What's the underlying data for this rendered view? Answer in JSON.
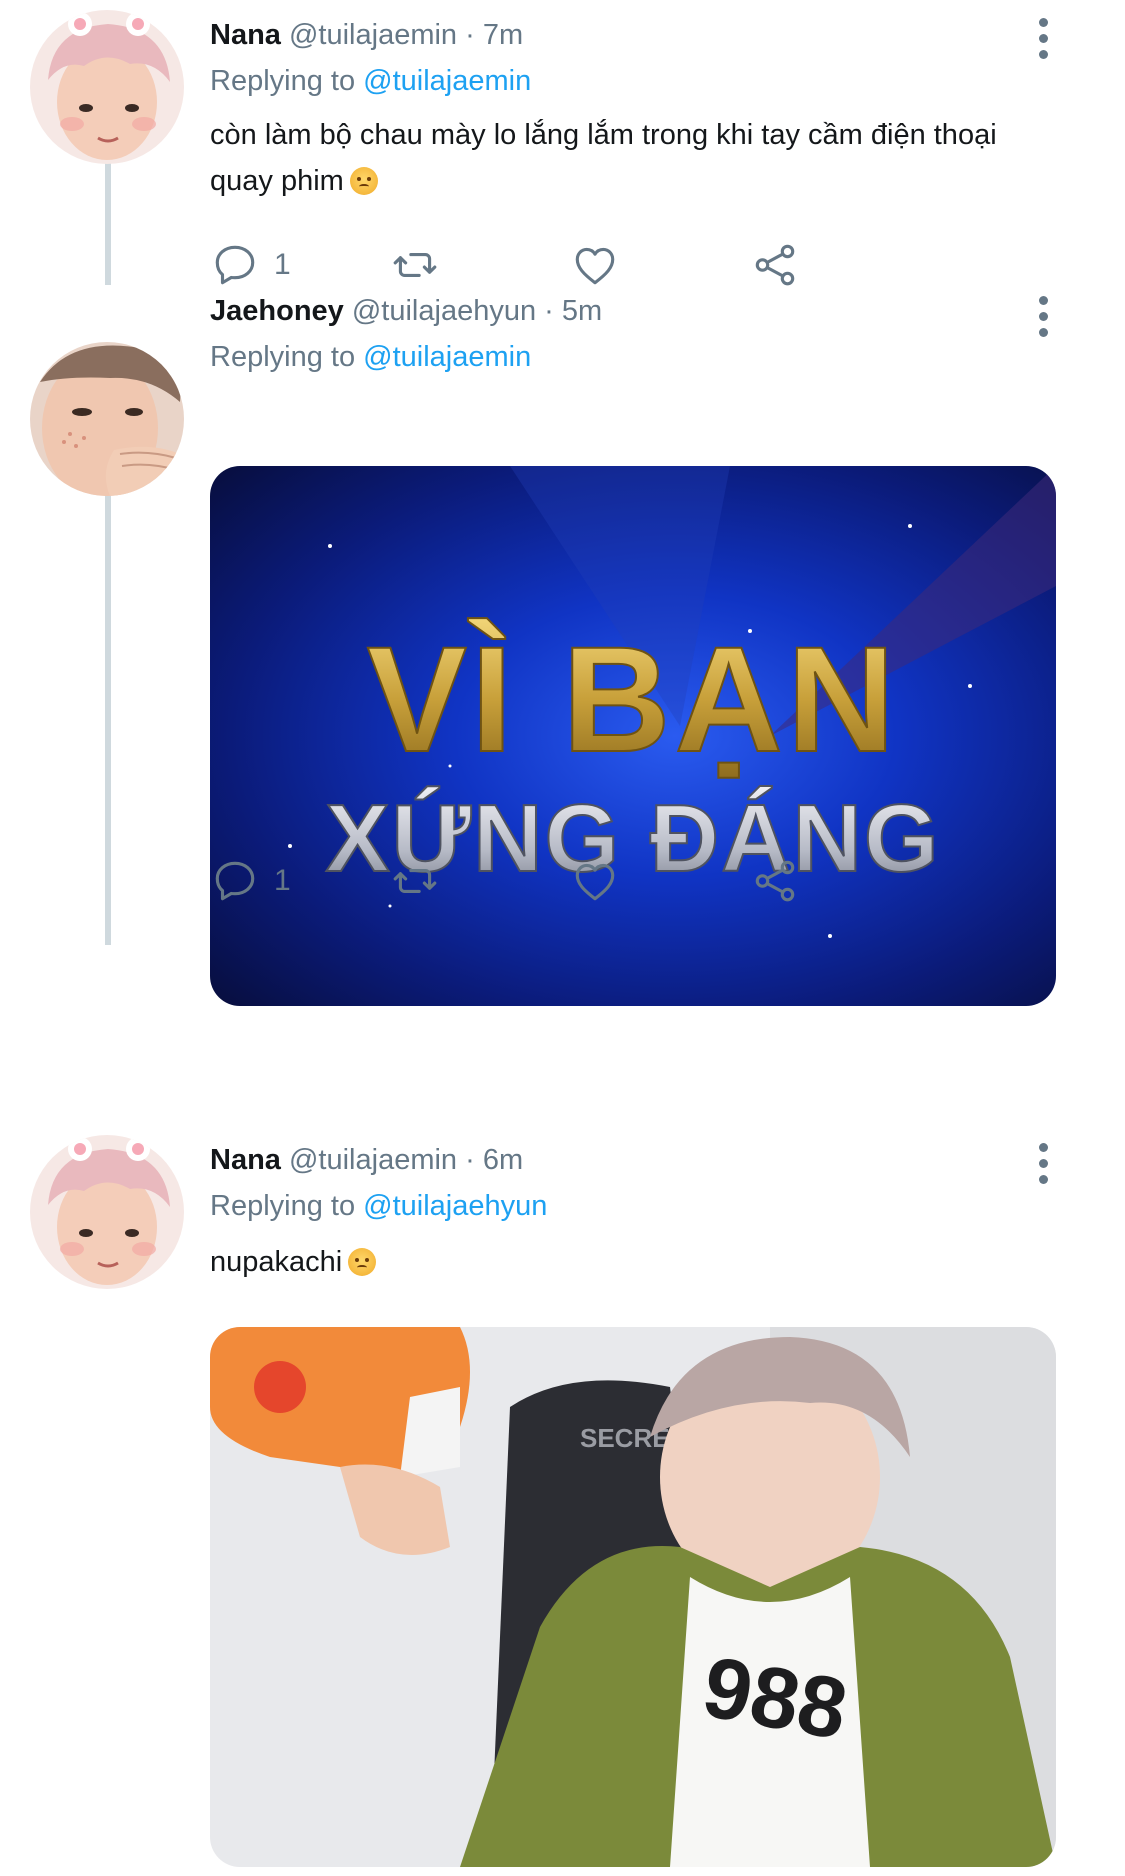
{
  "tweets": [
    {
      "name": "Nana",
      "handle": "@tuilajaemin",
      "separator": "·",
      "time": "7m",
      "replying_prefix": "Replying to",
      "replying_to": "@tuilajaemin",
      "text": "còn làm bộ chau mày lo lắng lắm trong khi tay cầm điện thoại quay phim",
      "emoji": "angry-face",
      "actions": {
        "reply_count": "1",
        "retweet_count": "",
        "like_count": ""
      }
    },
    {
      "name": "Jaehoney",
      "handle": "@tuilajaehyun",
      "separator": "·",
      "time": "5m",
      "replying_prefix": "Replying to",
      "replying_to": "@tuilajaemin",
      "media": {
        "line1": "VÌ BẠN",
        "line2": "XỨNG ĐÁNG"
      },
      "actions": {
        "reply_count": "1",
        "retweet_count": "",
        "like_count": ""
      }
    },
    {
      "name": "Nana",
      "handle": "@tuilajaemin",
      "separator": "·",
      "time": "6m",
      "replying_prefix": "Replying to",
      "replying_to": "@tuilajaehyun",
      "text": "nupakachi",
      "emoji": "angry-face",
      "media": {
        "shirt_text": "988"
      }
    }
  ],
  "colors": {
    "accent": "#1da1f2",
    "secondary_text": "#657786",
    "thread_line": "#cfd9de"
  }
}
